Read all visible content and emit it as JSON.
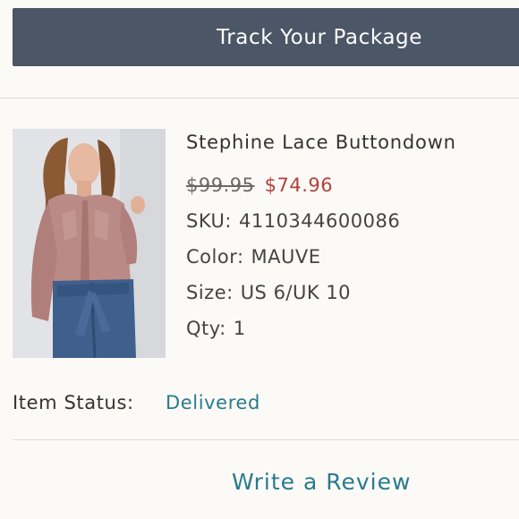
{
  "header": {
    "track_label": "Track Your Package"
  },
  "product": {
    "title": "Stephine Lace Buttondown",
    "old_price": "$99.95",
    "new_price": "$74.96",
    "sku_label": "SKU:",
    "sku_value": "4110344600086",
    "color_label": "Color:",
    "color_value": "MAUVE",
    "size_label": "Size:",
    "size_value": "US 6/UK 10",
    "qty_label": "Qty:",
    "qty_value": "1"
  },
  "status": {
    "label": "Item Status:",
    "value": "Delivered"
  },
  "actions": {
    "review_label": "Write a Review"
  },
  "colors": {
    "header_bg": "#4b5666",
    "sale_price": "#b5413d",
    "link": "#2a7a8e",
    "page_bg": "#fbfaf6"
  }
}
